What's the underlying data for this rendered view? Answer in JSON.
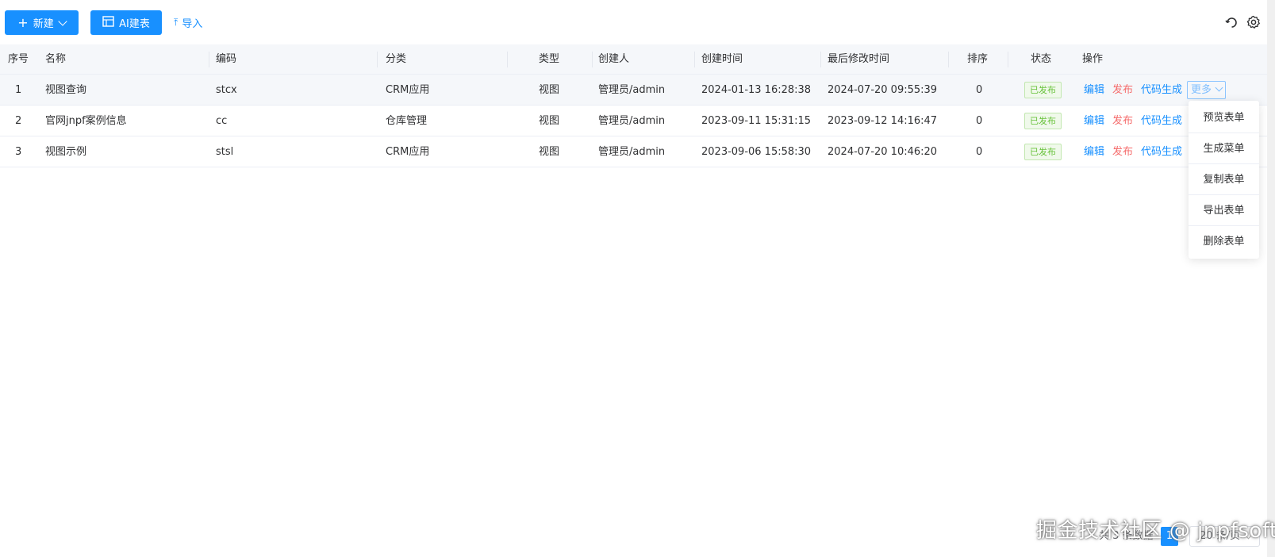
{
  "toolbar": {
    "new_label": "新建",
    "ai_label": "AI建表",
    "import_label": "导入"
  },
  "table": {
    "headers": {
      "seq": "序号",
      "name": "名称",
      "code": "编码",
      "category": "分类",
      "type": "类型",
      "creator": "创建人",
      "created": "创建时间",
      "modified": "最后修改时间",
      "sort": "排序",
      "status": "状态",
      "actions": "操作"
    },
    "rows": [
      {
        "seq": "1",
        "name": "视图查询",
        "code": "stcx",
        "category": "CRM应用",
        "type": "视图",
        "creator": "管理员/admin",
        "created": "2024-01-13 16:28:38",
        "modified": "2024-07-20 09:55:39",
        "sort": "0",
        "status": "已发布"
      },
      {
        "seq": "2",
        "name": "官网jnpf案例信息",
        "code": "cc",
        "category": "仓库管理",
        "type": "视图",
        "creator": "管理员/admin",
        "created": "2023-09-11 15:31:15",
        "modified": "2023-09-12 14:16:47",
        "sort": "0",
        "status": "已发布"
      },
      {
        "seq": "3",
        "name": "视图示例",
        "code": "stsl",
        "category": "CRM应用",
        "type": "视图",
        "creator": "管理员/admin",
        "created": "2023-09-06 15:58:30",
        "modified": "2024-07-20 10:46:20",
        "sort": "0",
        "status": "已发布"
      }
    ],
    "actions": {
      "edit": "编辑",
      "publish": "发布",
      "codegen": "代码生成",
      "more": "更多"
    }
  },
  "dropdown": {
    "items": [
      "预览表单",
      "生成菜单",
      "复制表单",
      "导出表单",
      "删除表单"
    ]
  },
  "pagination": {
    "total": "共 3 条数据",
    "current_page": "1",
    "page_size": "20 条/页"
  },
  "watermark": "掘金技术社区 @ jnpfsoft",
  "colors": {
    "primary": "#1890ff",
    "danger": "#f56c6c",
    "success": "#67c23a"
  }
}
